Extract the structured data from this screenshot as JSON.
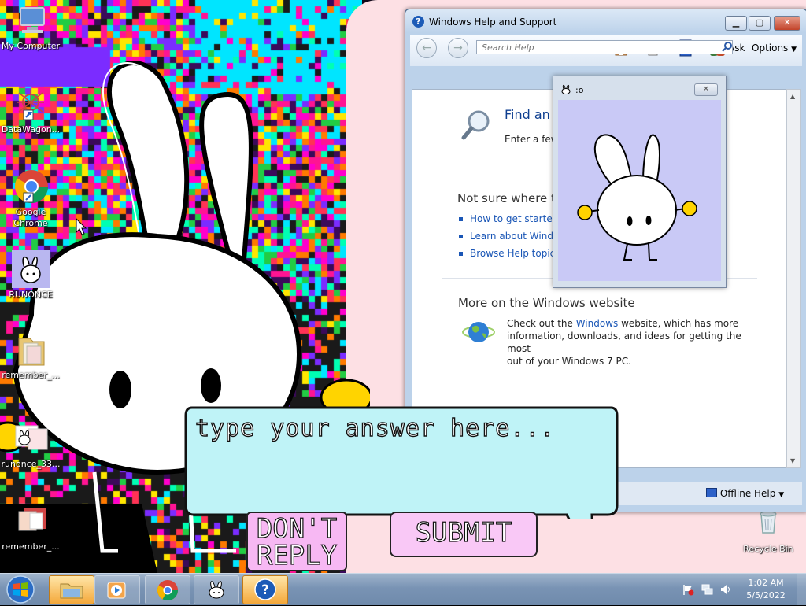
{
  "desktop": {
    "icons": [
      {
        "label": "My Computer"
      },
      {
        "label": "DataWagon..."
      },
      {
        "label": "Google Chrome"
      },
      {
        "label": "RUNONCE"
      },
      {
        "label": "remember_..."
      },
      {
        "label": "runonce_33..."
      },
      {
        "label": "remember_..."
      },
      {
        "label": "Recycle Bin"
      }
    ]
  },
  "help_window": {
    "title": "Windows Help and Support",
    "toolbar": {
      "ask": "Ask",
      "options": "Options"
    },
    "search": {
      "placeholder": "Search Help"
    },
    "find_heading": "Find an a",
    "find_text": "Enter a few w",
    "not_sure_heading": "Not sure where to",
    "links": [
      "How to get started w",
      "Learn about Window",
      "Browse Help topics"
    ],
    "more_heading": "More on the Windows website",
    "more_text_pre": "Check out the ",
    "more_link": "Windows",
    "more_text_line1_post": " website, which has more",
    "more_text_line2": "information, downloads, and ideas for getting the most",
    "more_text_line3": "out of your Windows 7 PC.",
    "offline_help": "Offline Help"
  },
  "bunny_window": {
    "title": ":o"
  },
  "answer": {
    "placeholder": "type your answer here..."
  },
  "buttons": {
    "dont_reply_line1": "DON'T",
    "dont_reply_line2": "REPLY",
    "submit": "SUBMIT"
  },
  "taskbar": {
    "time": "1:02 AM",
    "date": "5/5/2022"
  },
  "colors": {
    "help_accent": "#1a56b6",
    "bubble": "#bff3f7",
    "button_pink": "#f7b8f3",
    "desktop_pink": "#fde0e4"
  }
}
